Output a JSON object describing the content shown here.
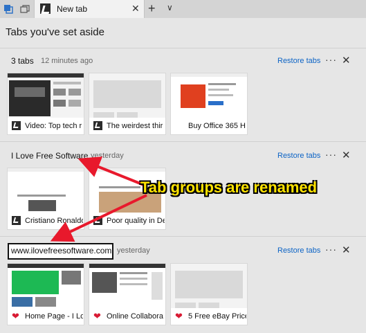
{
  "tabbar": {
    "tab_title": "New tab",
    "close_glyph": "✕",
    "new_tab_glyph": "+",
    "menu_glyph": "∨"
  },
  "pane": {
    "title": "Tabs you've set aside"
  },
  "groups": [
    {
      "name": "3 tabs",
      "time": "12 minutes ago",
      "restore": "Restore tabs",
      "more": "···",
      "close": "✕",
      "tabs": [
        {
          "title": "Video: Top tech r",
          "icon": "edge-favicon-icon"
        },
        {
          "title": "The weirdest thir",
          "icon": "edge-favicon-icon"
        },
        {
          "title": "Buy Office 365 H",
          "icon": "none"
        }
      ]
    },
    {
      "name": "I Love Free Software",
      "time": "yesterday",
      "restore": "Restore tabs",
      "more": "···",
      "close": "✕",
      "tabs": [
        {
          "title": "Cristiano Ronaldo",
          "icon": "edge-favicon-icon"
        },
        {
          "title": "Poor quality in Del",
          "icon": "edge-favicon-icon"
        }
      ]
    },
    {
      "name": "www.ilovefreesoftware.com",
      "time": "yesterday",
      "restore": "Restore tabs",
      "more": "···",
      "close": "✕",
      "tabs": [
        {
          "title": "Home Page - I Lo",
          "icon": "heart-icon"
        },
        {
          "title": "Online Collabora",
          "icon": "heart-icon"
        },
        {
          "title": "5 Free eBay Price",
          "icon": "heart-icon"
        }
      ]
    }
  ],
  "annotation": {
    "label": "Tab groups are renamed"
  },
  "colors": {
    "accent": "#0b63c5",
    "annotation_text": "#ffe300",
    "arrow": "#e8192c",
    "heart": "#d81b34"
  }
}
